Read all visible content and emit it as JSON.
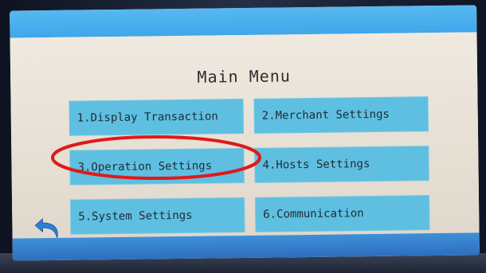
{
  "screen": {
    "title": "Main Menu"
  },
  "menu": {
    "items": [
      {
        "label": "1.Display Transaction"
      },
      {
        "label": "2.Merchant Settings"
      },
      {
        "label": "3.Operation Settings"
      },
      {
        "label": "4.Hosts Settings"
      },
      {
        "label": "5.System Settings"
      },
      {
        "label": "6.Communication"
      }
    ]
  },
  "icons": {
    "back": "back-arrow-icon"
  },
  "colors": {
    "title_bar": "#3fa7ea",
    "button": "#5ebfe1",
    "status_bar": "#2c6fc0",
    "highlight_annotation": "#e01919",
    "back_icon": "#2f7fd6"
  }
}
